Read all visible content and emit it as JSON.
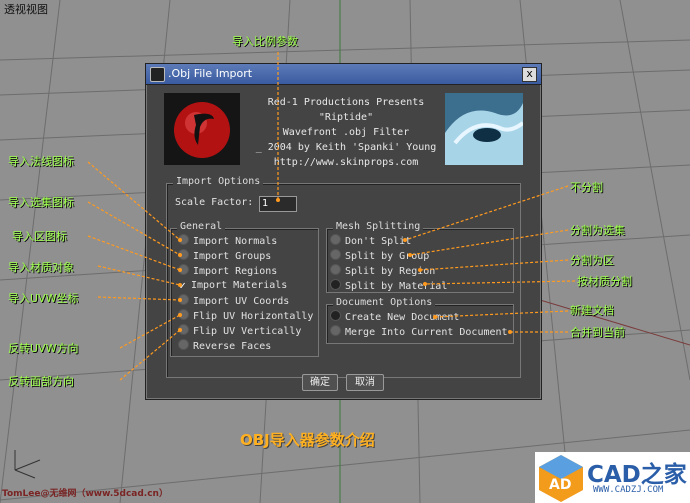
{
  "viewport": {
    "label": "透视视图"
  },
  "dialog": {
    "title": ".Obj File Import",
    "close_label": "x",
    "header_lines": [
      "Red-1 Productions Presents",
      "\"Riptide\"",
      "Wavefront .obj Filter",
      "_ 2004 by Keith 'Spanki' Young",
      "http://www.skinprops.com"
    ],
    "import_options": {
      "title": "Import Options",
      "scale_factor_label": "Scale Factor:",
      "scale_factor_value": "1"
    },
    "general": {
      "title": "General",
      "items": [
        {
          "label": "Import Normals",
          "checked": false
        },
        {
          "label": "Import Groups",
          "checked": false
        },
        {
          "label": "Import Regions",
          "checked": false
        },
        {
          "label": "Import Materials",
          "checked": true
        },
        {
          "label": "Import UV Coords",
          "checked": false
        },
        {
          "label": "Flip UV Horizontally",
          "checked": false
        },
        {
          "label": "Flip UV Vertically",
          "checked": false
        },
        {
          "label": "Reverse Faces",
          "checked": false
        }
      ]
    },
    "mesh_splitting": {
      "title": "Mesh Splitting",
      "items": [
        {
          "label": "Don't Split",
          "selected": false
        },
        {
          "label": "Split by Group",
          "selected": false
        },
        {
          "label": "Split by Region",
          "selected": false
        },
        {
          "label": "Split by Material",
          "selected": true
        }
      ]
    },
    "document_options": {
      "title": "Document Options",
      "items": [
        {
          "label": "Create New Document",
          "selected": true
        },
        {
          "label": "Merge Into Current Document",
          "selected": false
        }
      ]
    },
    "ok_label": "确定",
    "cancel_label": "取消"
  },
  "annotations": {
    "top": "导入比例参数",
    "left": [
      "导入法线图标",
      "导入选集图标",
      "导入区图标",
      "导入材质对象",
      "导入UVW坐标",
      "反转UVW方向",
      "反转面部方向"
    ],
    "right": [
      "不分割",
      "分割为选集",
      "分割为区",
      "按材质分割",
      "新建文档",
      "合并到当前"
    ]
  },
  "caption": "OBJ导入器参数介绍",
  "footer_left": "TomLee@无维网（www.5dcad.cn）",
  "badge": {
    "main": "CAD之家",
    "url": "WWW.CADZJ.COM",
    "logo": "AD"
  },
  "colors": {
    "annotation": "#9cff4a",
    "arrow": "#ff9a1f",
    "caption": "#ffb020"
  }
}
